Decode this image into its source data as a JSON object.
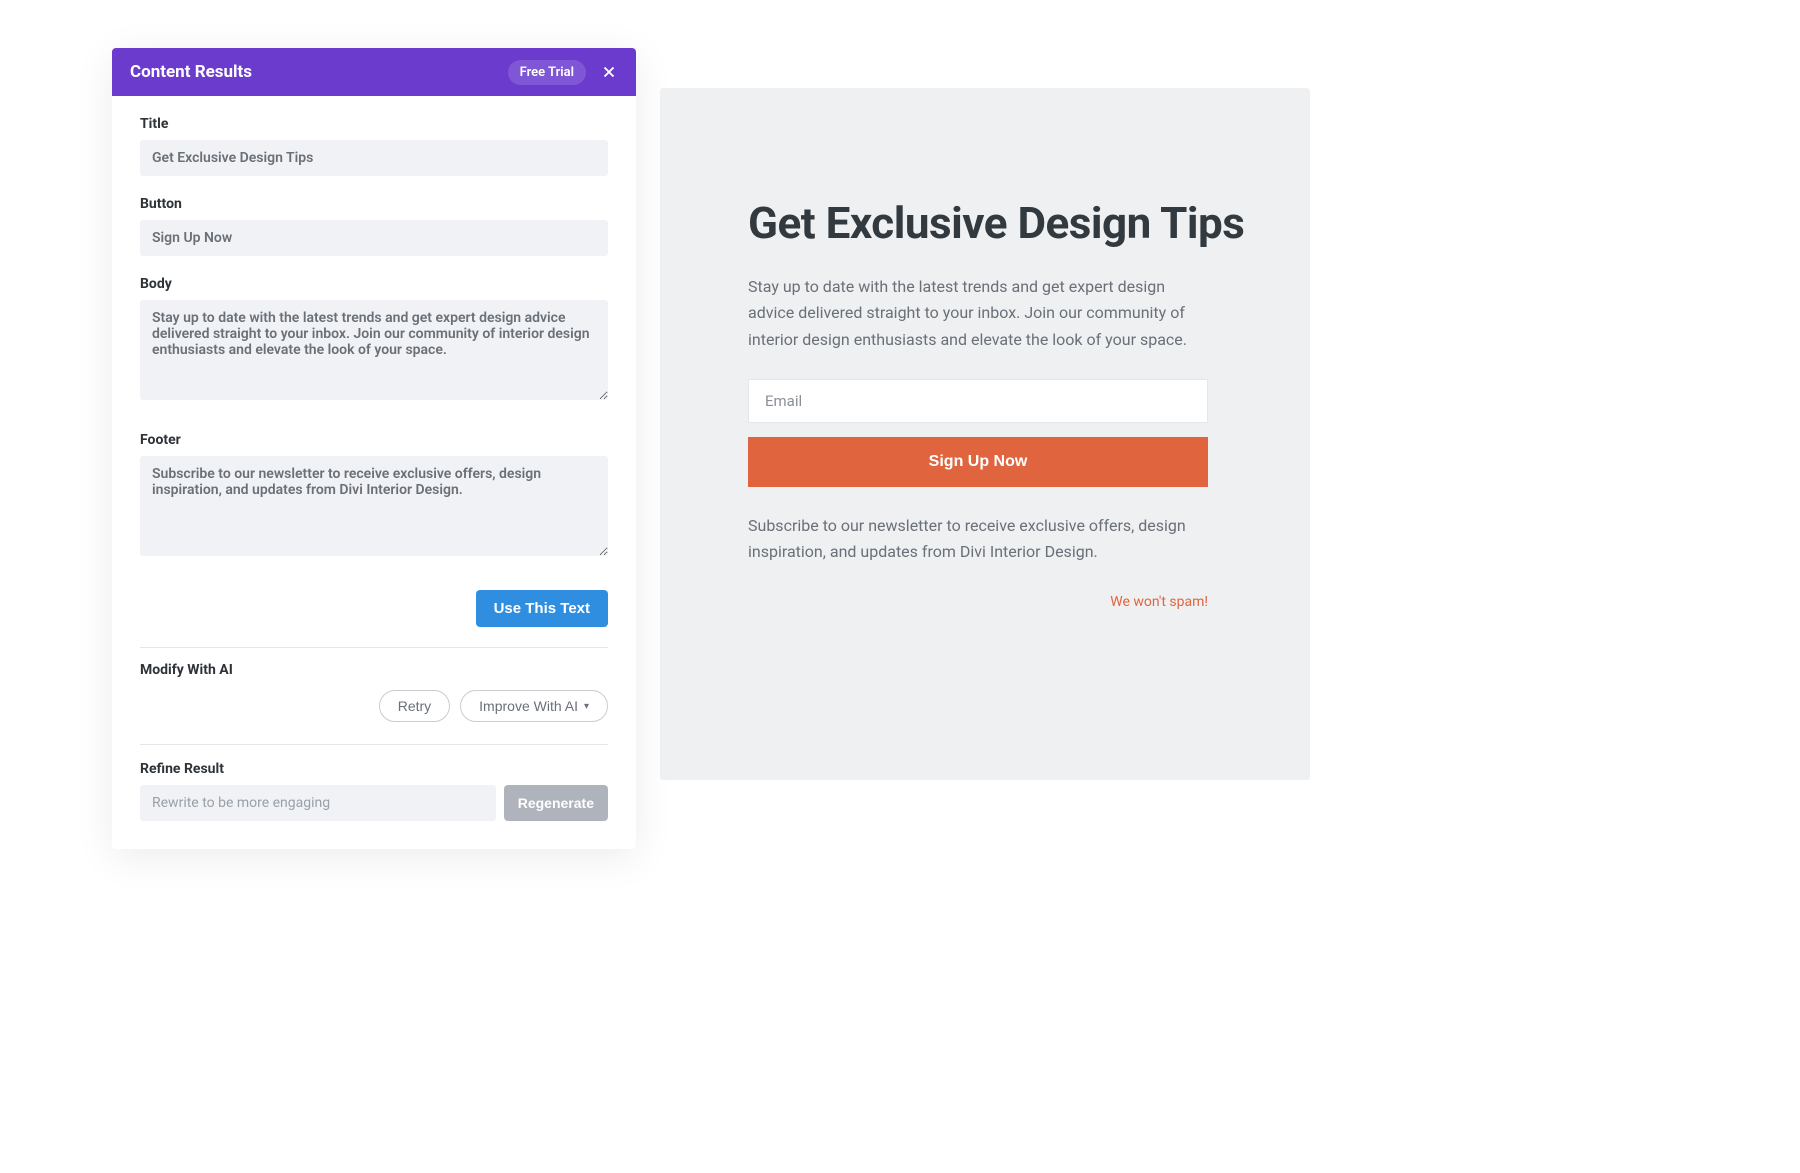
{
  "panel": {
    "header_title": "Content Results",
    "free_trial_label": "Free Trial",
    "labels": {
      "title": "Title",
      "button": "Button",
      "body": "Body",
      "footer": "Footer",
      "modify": "Modify With AI",
      "refine": "Refine Result"
    },
    "fields": {
      "title_value": "Get Exclusive Design Tips",
      "button_value": "Sign Up Now",
      "body_value": "Stay up to date with the latest trends and get expert design advice delivered straight to your inbox. Join our community of interior design enthusiasts and elevate the look of your space.",
      "footer_value": "Subscribe to our newsletter to receive exclusive offers, design inspiration, and updates from Divi Interior Design."
    },
    "buttons": {
      "use_text": "Use This Text",
      "retry": "Retry",
      "improve": "Improve With AI",
      "regenerate": "Regenerate"
    },
    "refine_placeholder": "Rewrite to be more engaging"
  },
  "preview": {
    "title": "Get Exclusive Design Tips",
    "body": "Stay up to date with the latest trends and get expert design advice delivered straight to your inbox. Join our community of interior design enthusiasts and elevate the look of your space.",
    "email_placeholder": "Email",
    "signup_label": "Sign Up Now",
    "footer": "Subscribe to our newsletter to receive exclusive offers, design inspiration, and updates from Divi Interior Design.",
    "spam_note": "We won't spam!"
  }
}
